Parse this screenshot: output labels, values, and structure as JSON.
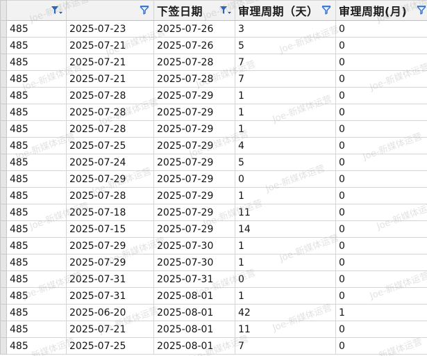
{
  "columns": [
    {
      "label": "",
      "filter_active": true
    },
    {
      "label": "",
      "filter_active": false
    },
    {
      "label": "下签日期",
      "filter_active": true
    },
    {
      "label": "审理周期（天）",
      "filter_active": false
    },
    {
      "label": "审理周期(月)",
      "filter_active": false
    }
  ],
  "rows": [
    [
      "485",
      "2025-07-23",
      "2025-07-26",
      "3",
      "0"
    ],
    [
      "485",
      "2025-07-21",
      "2025-07-26",
      "5",
      "0"
    ],
    [
      "485",
      "2025-07-21",
      "2025-07-28",
      "7",
      "0"
    ],
    [
      "485",
      "2025-07-21",
      "2025-07-28",
      "7",
      "0"
    ],
    [
      "485",
      "2025-07-28",
      "2025-07-29",
      "1",
      "0"
    ],
    [
      "485",
      "2025-07-28",
      "2025-07-29",
      "1",
      "0"
    ],
    [
      "485",
      "2025-07-28",
      "2025-07-29",
      "1",
      "0"
    ],
    [
      "485",
      "2025-07-25",
      "2025-07-29",
      "4",
      "0"
    ],
    [
      "485",
      "2025-07-24",
      "2025-07-29",
      "5",
      "0"
    ],
    [
      "485",
      "2025-07-29",
      "2025-07-29",
      "0",
      "0"
    ],
    [
      "485",
      "2025-07-28",
      "2025-07-29",
      "1",
      "0"
    ],
    [
      "485",
      "2025-07-18",
      "2025-07-29",
      "11",
      "0"
    ],
    [
      "485",
      "2025-07-15",
      "2025-07-29",
      "14",
      "0"
    ],
    [
      "485",
      "2025-07-29",
      "2025-07-30",
      "1",
      "0"
    ],
    [
      "485",
      "2025-07-29",
      "2025-07-30",
      "1",
      "0"
    ],
    [
      "485",
      "2025-07-31",
      "2025-07-31",
      "0",
      "0"
    ],
    [
      "485",
      "2025-07-31",
      "2025-08-01",
      "1",
      "0"
    ],
    [
      "485",
      "2025-06-20",
      "2025-08-01",
      "42",
      "1"
    ],
    [
      "485",
      "2025-07-21",
      "2025-08-01",
      "11",
      "0"
    ],
    [
      "485",
      "2025-07-25",
      "2025-08-01",
      "7",
      "0"
    ]
  ],
  "watermark": "Joe-新媒体运营",
  "colors": {
    "filter_active": "#1f5fbf",
    "filter_inactive": "#2b6fd6",
    "header_bg": "#f2f2f2",
    "grid_line": "#d4d4d4"
  },
  "icons": {
    "filter": "funnel-filter-icon",
    "filter_active": "funnel-filter-applied-icon"
  }
}
